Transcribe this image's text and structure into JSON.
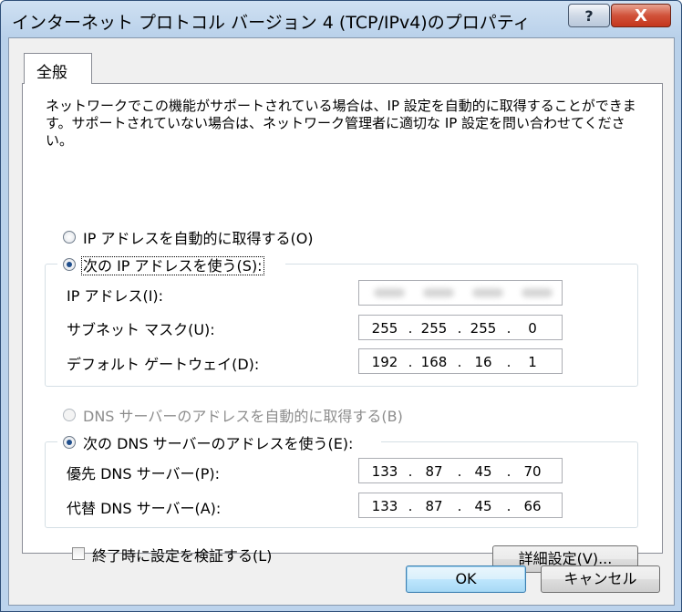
{
  "window": {
    "title": "インターネット プロトコル バージョン 4 (TCP/IPv4)のプロパティ",
    "help_glyph": "?",
    "close_glyph": "X"
  },
  "tabs": [
    {
      "label": "全般",
      "selected": true
    }
  ],
  "description": "ネットワークでこの機能がサポートされている場合は、IP 設定を自動的に取得することができます。サポートされていない場合は、ネットワーク管理者に適切な IP 設定を問い合わせてください。",
  "ip_section": {
    "auto_label": "IP アドレスを自動的に取得する(O)",
    "auto_selected": false,
    "manual_label": "次の IP アドレスを使う(S):",
    "manual_selected": true,
    "fields": {
      "ip_address": {
        "label": "IP アドレス(I):",
        "octets": [
          "",
          "",
          "",
          ""
        ],
        "obscured": true
      },
      "subnet_mask": {
        "label": "サブネット マスク(U):",
        "octets": [
          "255",
          "255",
          "255",
          "0"
        ]
      },
      "default_gateway": {
        "label": "デフォルト ゲートウェイ(D):",
        "octets": [
          "192",
          "168",
          "16",
          "1"
        ]
      }
    }
  },
  "dns_section": {
    "auto_label": "DNS サーバーのアドレスを自動的に取得する(B)",
    "auto_enabled": false,
    "manual_label": "次の DNS サーバーのアドレスを使う(E):",
    "manual_selected": true,
    "fields": {
      "preferred": {
        "label": "優先 DNS サーバー(P):",
        "octets": [
          "133",
          "87",
          "45",
          "70"
        ]
      },
      "alternate": {
        "label": "代替 DNS サーバー(A):",
        "octets": [
          "133",
          "87",
          "45",
          "66"
        ]
      }
    }
  },
  "validate_on_exit": {
    "label": "終了時に設定を検証する(L)",
    "checked": false
  },
  "buttons": {
    "advanced": "詳細設定(V)...",
    "ok": "OK",
    "cancel": "キャンセル"
  },
  "ip_separator": "."
}
